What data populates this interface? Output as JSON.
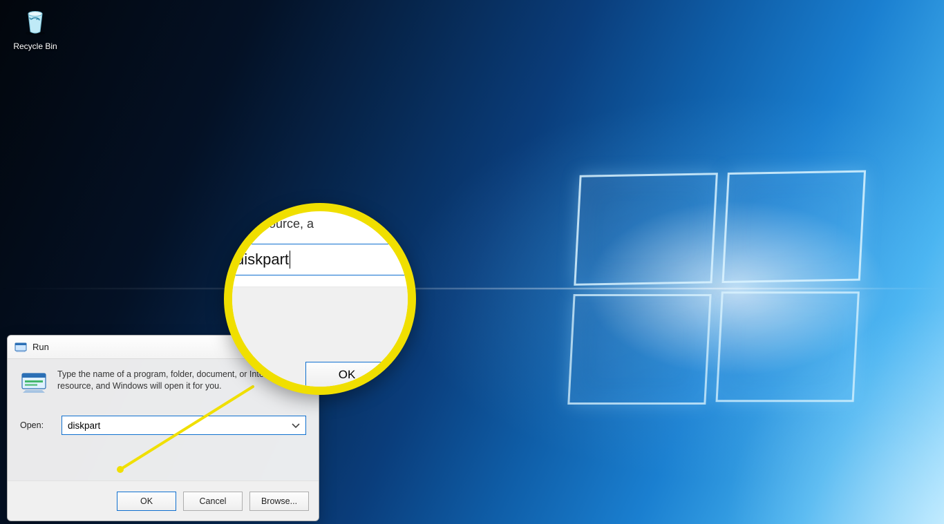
{
  "desktop": {
    "recycle_bin_label": "Recycle Bin"
  },
  "run": {
    "title": "Run",
    "description": "Type the name of a program, folder, document, or Internet resource, and Windows will open it for you.",
    "open_label": "Open:",
    "open_value": "diskpart",
    "buttons": {
      "ok": "OK",
      "cancel": "Cancel",
      "browse": "Browse..."
    }
  },
  "callout": {
    "cropped_text": "et resource, a",
    "input_value": "diskpart",
    "ok_label": "OK"
  }
}
